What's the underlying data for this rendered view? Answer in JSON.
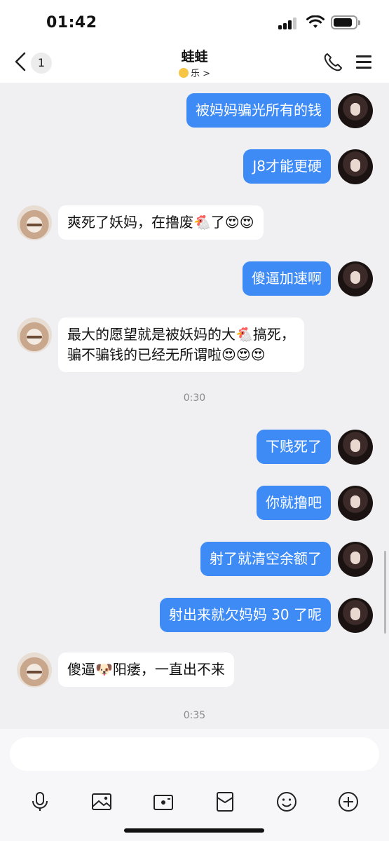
{
  "status_bar": {
    "time": "01:42",
    "battery_level": 0.85
  },
  "header": {
    "unread_count": "1",
    "contact_name": "蛙蛙",
    "contact_status": "乐 >",
    "status_icon": "smiley-icon",
    "back_icon": "chevron-left-icon",
    "call_icon": "phone-icon",
    "menu_icon": "hamburger-menu-icon"
  },
  "colors": {
    "my_bubble": "#3e8bf6",
    "their_bubble": "#ffffff",
    "chat_background": "#f0f0f2"
  },
  "messages": [
    {
      "sender": "me",
      "text": "被妈妈骗光所有的钱"
    },
    {
      "sender": "me",
      "text": "J8才能更硬"
    },
    {
      "sender": "other",
      "text": "爽死了妖妈，在撸废🐔了😍😍"
    },
    {
      "sender": "me",
      "text": "傻逼加速啊"
    },
    {
      "sender": "other",
      "text": "最大的愿望就是被妖妈的大🐔搞死，\n骗不骗钱的已经无所谓啦😍😍😍"
    },
    {
      "timestamp": "0:30"
    },
    {
      "sender": "me",
      "text": "下贱死了"
    },
    {
      "sender": "me",
      "text": "你就撸吧"
    },
    {
      "sender": "me",
      "text": "射了就清空余额了"
    },
    {
      "sender": "me",
      "text": "射出来就欠妈妈 30 了呢"
    },
    {
      "sender": "other",
      "text": "傻逼🐶阳痿，一直出不来"
    },
    {
      "timestamp": "0:35"
    }
  ],
  "input": {
    "value": "",
    "placeholder": ""
  },
  "toolbar": [
    {
      "icon": "microphone-icon"
    },
    {
      "icon": "image-icon"
    },
    {
      "icon": "camera-icon"
    },
    {
      "icon": "red-packet-icon"
    },
    {
      "icon": "emoji-icon"
    },
    {
      "icon": "plus-icon"
    }
  ]
}
